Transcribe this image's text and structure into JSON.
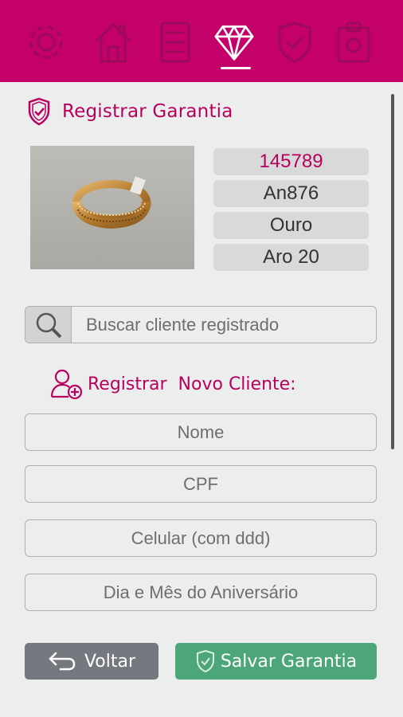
{
  "nav": {
    "items": [
      {
        "name": "settings-icon",
        "active": false
      },
      {
        "name": "home-icon",
        "active": false
      },
      {
        "name": "checklist-icon",
        "active": false
      },
      {
        "name": "diamond-icon",
        "active": true
      },
      {
        "name": "shield-check-icon",
        "active": false
      },
      {
        "name": "clipboard-icon",
        "active": false
      }
    ]
  },
  "section": {
    "title": "Registrar Garantia",
    "icon": "shield-check-icon"
  },
  "product": {
    "image": "gold-ring-photo",
    "code": "145789",
    "model": "An876",
    "material": "Ouro",
    "size": "Aro 20"
  },
  "search": {
    "placeholder": "Buscar cliente registrado",
    "icon": "search-icon"
  },
  "new_client": {
    "title": "Registrar  Novo Cliente:",
    "icon": "add-user-icon",
    "fields": {
      "name": "Nome",
      "cpf": "CPF",
      "phone": "Celular (com ddd)",
      "birthday": "Dia e Mês do Aniversário"
    }
  },
  "buttons": {
    "back_label": "Voltar",
    "save_label": "Salvar Garantia"
  },
  "colors": {
    "brand": "#c4006a",
    "save": "#4da679",
    "back": "#76787f"
  }
}
